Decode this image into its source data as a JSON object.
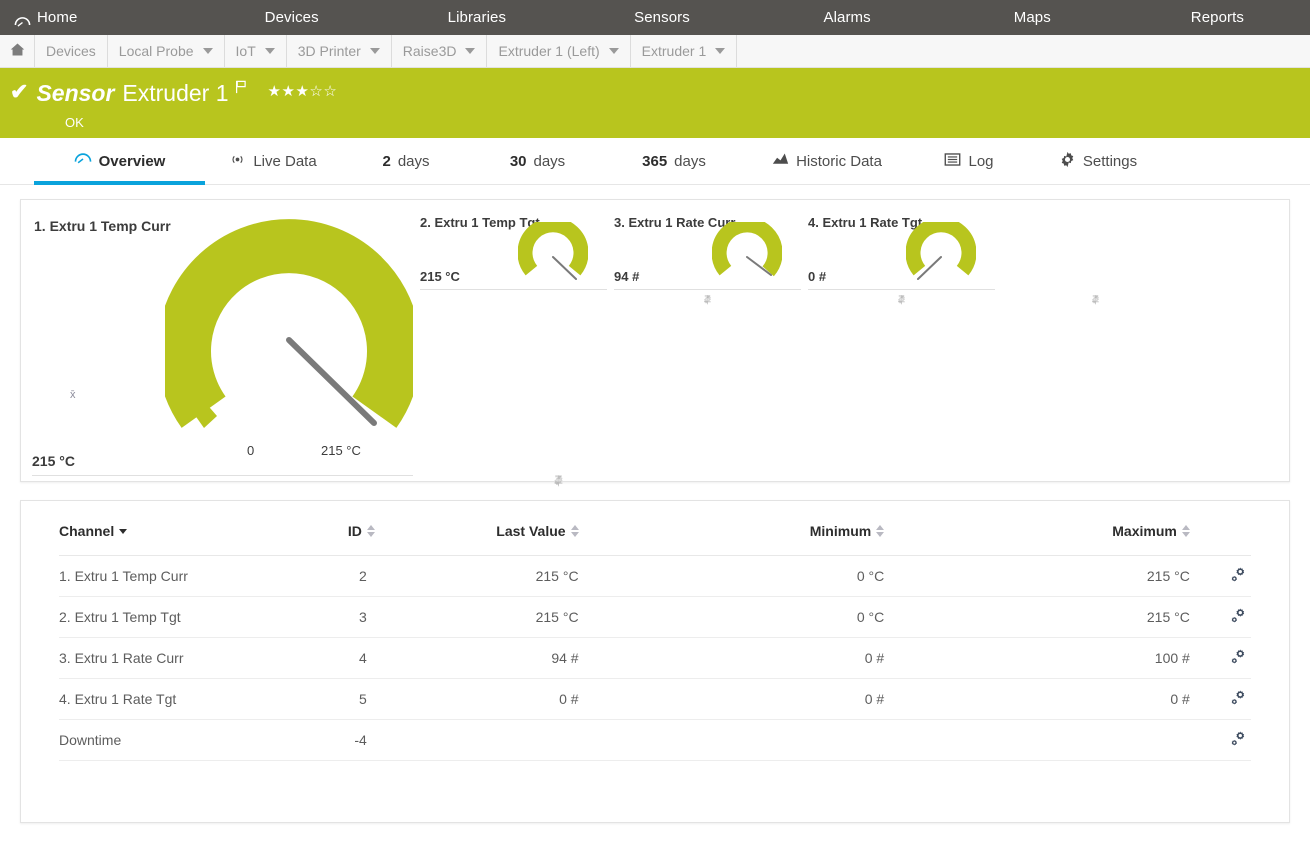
{
  "topnav": {
    "items": [
      {
        "label": "Home",
        "icon": "gauge-icon"
      },
      {
        "label": "Devices"
      },
      {
        "label": "Libraries"
      },
      {
        "label": "Sensors"
      },
      {
        "label": "Alarms"
      },
      {
        "label": "Maps"
      },
      {
        "label": "Reports"
      }
    ]
  },
  "breadcrumb": {
    "home_icon": "home-icon",
    "items": [
      {
        "label": "Devices",
        "has_dropdown": false
      },
      {
        "label": "Local Probe",
        "has_dropdown": true
      },
      {
        "label": "IoT",
        "has_dropdown": true
      },
      {
        "label": "3D Printer",
        "has_dropdown": true
      },
      {
        "label": "Raise3D",
        "has_dropdown": true
      },
      {
        "label": "Extruder 1 (Left)",
        "has_dropdown": true
      },
      {
        "label": "Extruder 1",
        "has_dropdown": true
      }
    ]
  },
  "status": {
    "check_glyph": "✔",
    "type_label": "Sensor",
    "name": "Extruder 1",
    "flag_icon": "flag-icon",
    "stars_filled": 3,
    "stars_total": 5,
    "state": "OK",
    "bg_color": "#b8c51e"
  },
  "tabs": [
    {
      "label": "Overview",
      "icon": "gauge-icon",
      "active": true
    },
    {
      "label": "Live Data",
      "icon": "live-data-icon",
      "active": false
    },
    {
      "num": "2",
      "unit": "days",
      "active": false
    },
    {
      "num": "30",
      "unit": "days",
      "active": false
    },
    {
      "num": "365",
      "unit": "days",
      "active": false
    },
    {
      "label": "Historic Data",
      "icon": "chart-icon",
      "active": false
    },
    {
      "label": "Log",
      "icon": "log-icon",
      "active": false
    },
    {
      "label": "Settings",
      "icon": "gear-icon",
      "active": false
    }
  ],
  "gauges": {
    "accent_color": "#b8c51e",
    "needle_color": "#7a7a7a",
    "primary": {
      "title": "1. Extru 1 Temp Curr",
      "value": "215 °C",
      "scale_min_label": "0",
      "scale_max_label": "215 °C",
      "mean_marker": "x̄",
      "percent": 100
    },
    "secondary": [
      {
        "title": "2. Extru 1 Temp Tgt",
        "value": "215 °C",
        "percent": 100
      },
      {
        "title": "3. Extru 1 Rate Curr",
        "value": "94 #",
        "percent": 94
      },
      {
        "title": "4. Extru 1 Rate Tgt",
        "value": "0 #",
        "percent": 0
      }
    ],
    "foot_icons": [
      "gear-icon",
      "pin-icon"
    ]
  },
  "channel_table": {
    "columns": [
      {
        "key": "channel",
        "label": "Channel",
        "sort": "desc"
      },
      {
        "key": "id",
        "label": "ID",
        "sort": "none"
      },
      {
        "key": "last",
        "label": "Last Value",
        "sort": "none"
      },
      {
        "key": "min",
        "label": "Minimum",
        "sort": "none"
      },
      {
        "key": "max",
        "label": "Maximum",
        "sort": "none"
      }
    ],
    "rows": [
      {
        "channel": "1. Extru 1 Temp Curr",
        "id": "2",
        "last": "215 °C",
        "min": "0 °C",
        "max": "215 °C",
        "action_icon": "gears-icon"
      },
      {
        "channel": "2. Extru 1 Temp Tgt",
        "id": "3",
        "last": "215 °C",
        "min": "0 °C",
        "max": "215 °C",
        "action_icon": "gears-icon"
      },
      {
        "channel": "3. Extru 1 Rate Curr",
        "id": "4",
        "last": "94 #",
        "min": "0 #",
        "max": "100 #",
        "action_icon": "gears-icon"
      },
      {
        "channel": "4. Extru 1 Rate Tgt",
        "id": "5",
        "last": "0 #",
        "min": "0 #",
        "max": "0 #",
        "action_icon": "gears-icon"
      },
      {
        "channel": "Downtime",
        "id": "-4",
        "last": "",
        "min": "",
        "max": "",
        "action_icon": "gears-icon"
      }
    ]
  }
}
